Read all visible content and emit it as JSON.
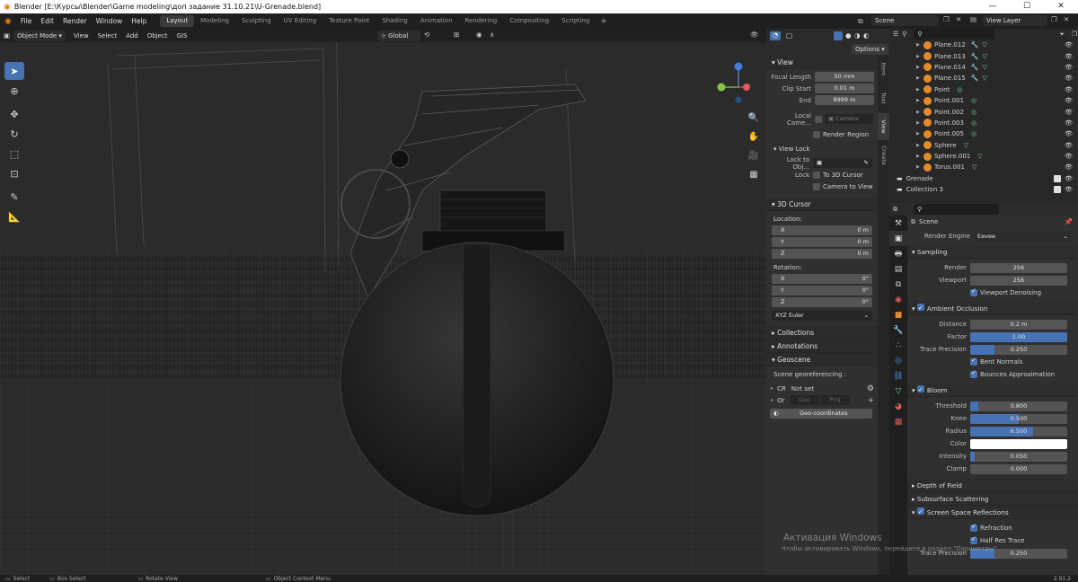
{
  "title_bar": {
    "text": "Blender [E:\\Курсы\\Blender\\Game modeling\\доп задание 31.10.21\\U-Grenade.blend]"
  },
  "menu": [
    "File",
    "Edit",
    "Render",
    "Window",
    "Help"
  ],
  "workspaces": [
    "Layout",
    "Modeling",
    "Sculpting",
    "UV Editing",
    "Texture Paint",
    "Shading",
    "Animation",
    "Rendering",
    "Compositing",
    "Scripting"
  ],
  "active_workspace": "Layout",
  "scene_field": "Scene",
  "view_layer_field": "View Layer",
  "viewport_header": {
    "mode": "Object Mode",
    "menus": [
      "View",
      "Select",
      "Add",
      "Object",
      "GIS"
    ],
    "orientation": "Global",
    "options": "Options"
  },
  "tools": [
    "select-box",
    "cursor",
    "move",
    "rotate",
    "scale",
    "transform",
    "annotate",
    "measure"
  ],
  "npanel": {
    "view_title": "View",
    "focal_length_label": "Focal Length",
    "focal_length": "50 mm",
    "clip_start_label": "Clip Start",
    "clip_start": "0.01 m",
    "end_label": "End",
    "end": "9999 m",
    "local_camera_label": "Local Came...",
    "camera_placeholder": "Camera",
    "render_region": "Render Region",
    "view_lock_title": "View Lock",
    "lock_to_obj_label": "Lock to Obj...",
    "lock_label": "Lock",
    "to_3d_cursor": "To 3D Cursor",
    "camera_to_view": "Camera to View",
    "cursor_title": "3D Cursor",
    "location_label": "Location:",
    "loc": [
      {
        "axis": "X",
        "val": "0 m"
      },
      {
        "axis": "Y",
        "val": "0 m"
      },
      {
        "axis": "Z",
        "val": "0 m"
      }
    ],
    "rotation_label": "Rotation:",
    "rot": [
      {
        "axis": "X",
        "val": "0°"
      },
      {
        "axis": "Y",
        "val": "0°"
      },
      {
        "axis": "Z",
        "val": "0°"
      }
    ],
    "rotation_mode": "XYZ Euler",
    "collections": "Collections",
    "annotations": "Annotations",
    "geoscene": "Geoscene",
    "georef_label": "Scene georeferencing :",
    "cr_label": "CR",
    "cr_value": "Not set",
    "or_label": "Or",
    "geo_btn": "Geo",
    "proj_btn": "Proj",
    "geo_coords_btn": "Geo-coordinates"
  },
  "side_tabs": [
    "Item",
    "Tool",
    "View",
    "Create"
  ],
  "active_side_tab": "View",
  "outliner": {
    "items": [
      {
        "name": "Plane.012",
        "kind": "mesh",
        "mod": true
      },
      {
        "name": "Plane.013",
        "kind": "mesh",
        "mod": true
      },
      {
        "name": "Plane.014",
        "kind": "mesh",
        "mod": true
      },
      {
        "name": "Plane.015",
        "kind": "mesh",
        "mod": true
      },
      {
        "name": "Point",
        "kind": "light",
        "mod": false
      },
      {
        "name": "Point.001",
        "kind": "light",
        "mod": false
      },
      {
        "name": "Point.002",
        "kind": "light",
        "mod": false
      },
      {
        "name": "Point.003",
        "kind": "light",
        "mod": false
      },
      {
        "name": "Point.005",
        "kind": "light",
        "mod": false
      },
      {
        "name": "Sphere",
        "kind": "mesh",
        "mod": false
      },
      {
        "name": "Sphere.001",
        "kind": "mesh",
        "mod": false
      },
      {
        "name": "Torus.001",
        "kind": "mesh",
        "mod": false
      }
    ],
    "collections": [
      "Grenade",
      "Collection 3"
    ]
  },
  "properties": {
    "scene_label": "Scene",
    "render_engine_label": "Render Engine",
    "render_engine": "Eevee",
    "sampling": "Sampling",
    "render_label": "Render",
    "render_samples": "256",
    "viewport_label": "Viewport",
    "viewport_samples": "256",
    "viewport_denoising": "Viewport Denoising",
    "ao": "Ambient Occlusion",
    "distance_label": "Distance",
    "distance": "0.2 m",
    "factor_label": "Factor",
    "factor": "1.00",
    "factor_fill": 1.0,
    "trace_precision_label": "Trace Precision",
    "trace_precision": "0.250",
    "trace_precision_fill": 0.25,
    "bent_normals": "Bent Normals",
    "bounces_approx": "Bounces Approximation",
    "bloom": "Bloom",
    "threshold_label": "Threshold",
    "threshold": "0.800",
    "threshold_fill": 0.08,
    "knee_label": "Knee",
    "knee": "0.500",
    "knee_fill": 0.5,
    "radius_label": "Radius",
    "radius": "6.500",
    "radius_fill": 0.65,
    "color_label": "Color",
    "intensity_label": "Intensity",
    "intensity": "0.050",
    "intensity_fill": 0.05,
    "clamp_label": "Clamp",
    "clamp": "0.000",
    "depth_of_field": "Depth of Field",
    "subsurface": "Subsurface Scattering",
    "ssr": "Screen Space Reflections",
    "refraction": "Refraction",
    "half_res": "Half Res Trace",
    "trace_precision2": "0.250"
  },
  "status": {
    "select": "Select",
    "box_select": "Box Select",
    "rotate_view": "Rotate View",
    "context_menu": "Object Context Menu",
    "version": "2.91.2"
  },
  "watermark": {
    "line1": "Активация Windows",
    "line2": "Чтобы активировать Windows, перейдите в раздел \"Параметры\"."
  },
  "colors": {
    "accent": "#4772b3",
    "mesh_tri": "#7fd49a",
    "object_orange": "#e38b2c",
    "light_green": "#6fcf8a"
  }
}
